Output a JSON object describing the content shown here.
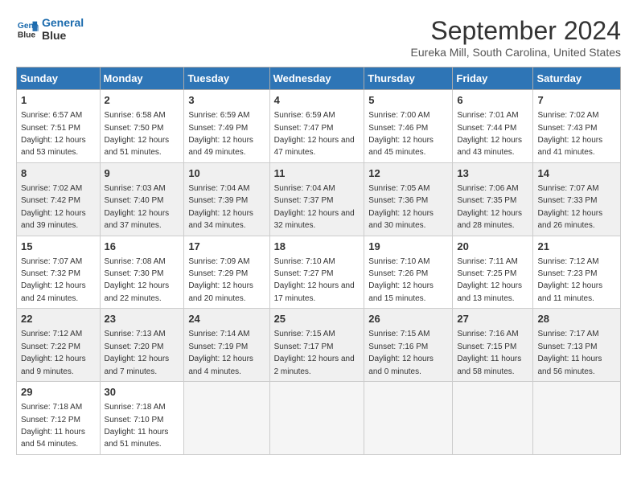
{
  "logo": {
    "line1": "General",
    "line2": "Blue"
  },
  "title": "September 2024",
  "subtitle": "Eureka Mill, South Carolina, United States",
  "days_of_week": [
    "Sunday",
    "Monday",
    "Tuesday",
    "Wednesday",
    "Thursday",
    "Friday",
    "Saturday"
  ],
  "weeks": [
    [
      {
        "day": "1",
        "sunrise": "Sunrise: 6:57 AM",
        "sunset": "Sunset: 7:51 PM",
        "daylight": "Daylight: 12 hours and 53 minutes."
      },
      {
        "day": "2",
        "sunrise": "Sunrise: 6:58 AM",
        "sunset": "Sunset: 7:50 PM",
        "daylight": "Daylight: 12 hours and 51 minutes."
      },
      {
        "day": "3",
        "sunrise": "Sunrise: 6:59 AM",
        "sunset": "Sunset: 7:49 PM",
        "daylight": "Daylight: 12 hours and 49 minutes."
      },
      {
        "day": "4",
        "sunrise": "Sunrise: 6:59 AM",
        "sunset": "Sunset: 7:47 PM",
        "daylight": "Daylight: 12 hours and 47 minutes."
      },
      {
        "day": "5",
        "sunrise": "Sunrise: 7:00 AM",
        "sunset": "Sunset: 7:46 PM",
        "daylight": "Daylight: 12 hours and 45 minutes."
      },
      {
        "day": "6",
        "sunrise": "Sunrise: 7:01 AM",
        "sunset": "Sunset: 7:44 PM",
        "daylight": "Daylight: 12 hours and 43 minutes."
      },
      {
        "day": "7",
        "sunrise": "Sunrise: 7:02 AM",
        "sunset": "Sunset: 7:43 PM",
        "daylight": "Daylight: 12 hours and 41 minutes."
      }
    ],
    [
      {
        "day": "8",
        "sunrise": "Sunrise: 7:02 AM",
        "sunset": "Sunset: 7:42 PM",
        "daylight": "Daylight: 12 hours and 39 minutes."
      },
      {
        "day": "9",
        "sunrise": "Sunrise: 7:03 AM",
        "sunset": "Sunset: 7:40 PM",
        "daylight": "Daylight: 12 hours and 37 minutes."
      },
      {
        "day": "10",
        "sunrise": "Sunrise: 7:04 AM",
        "sunset": "Sunset: 7:39 PM",
        "daylight": "Daylight: 12 hours and 34 minutes."
      },
      {
        "day": "11",
        "sunrise": "Sunrise: 7:04 AM",
        "sunset": "Sunset: 7:37 PM",
        "daylight": "Daylight: 12 hours and 32 minutes."
      },
      {
        "day": "12",
        "sunrise": "Sunrise: 7:05 AM",
        "sunset": "Sunset: 7:36 PM",
        "daylight": "Daylight: 12 hours and 30 minutes."
      },
      {
        "day": "13",
        "sunrise": "Sunrise: 7:06 AM",
        "sunset": "Sunset: 7:35 PM",
        "daylight": "Daylight: 12 hours and 28 minutes."
      },
      {
        "day": "14",
        "sunrise": "Sunrise: 7:07 AM",
        "sunset": "Sunset: 7:33 PM",
        "daylight": "Daylight: 12 hours and 26 minutes."
      }
    ],
    [
      {
        "day": "15",
        "sunrise": "Sunrise: 7:07 AM",
        "sunset": "Sunset: 7:32 PM",
        "daylight": "Daylight: 12 hours and 24 minutes."
      },
      {
        "day": "16",
        "sunrise": "Sunrise: 7:08 AM",
        "sunset": "Sunset: 7:30 PM",
        "daylight": "Daylight: 12 hours and 22 minutes."
      },
      {
        "day": "17",
        "sunrise": "Sunrise: 7:09 AM",
        "sunset": "Sunset: 7:29 PM",
        "daylight": "Daylight: 12 hours and 20 minutes."
      },
      {
        "day": "18",
        "sunrise": "Sunrise: 7:10 AM",
        "sunset": "Sunset: 7:27 PM",
        "daylight": "Daylight: 12 hours and 17 minutes."
      },
      {
        "day": "19",
        "sunrise": "Sunrise: 7:10 AM",
        "sunset": "Sunset: 7:26 PM",
        "daylight": "Daylight: 12 hours and 15 minutes."
      },
      {
        "day": "20",
        "sunrise": "Sunrise: 7:11 AM",
        "sunset": "Sunset: 7:25 PM",
        "daylight": "Daylight: 12 hours and 13 minutes."
      },
      {
        "day": "21",
        "sunrise": "Sunrise: 7:12 AM",
        "sunset": "Sunset: 7:23 PM",
        "daylight": "Daylight: 12 hours and 11 minutes."
      }
    ],
    [
      {
        "day": "22",
        "sunrise": "Sunrise: 7:12 AM",
        "sunset": "Sunset: 7:22 PM",
        "daylight": "Daylight: 12 hours and 9 minutes."
      },
      {
        "day": "23",
        "sunrise": "Sunrise: 7:13 AM",
        "sunset": "Sunset: 7:20 PM",
        "daylight": "Daylight: 12 hours and 7 minutes."
      },
      {
        "day": "24",
        "sunrise": "Sunrise: 7:14 AM",
        "sunset": "Sunset: 7:19 PM",
        "daylight": "Daylight: 12 hours and 4 minutes."
      },
      {
        "day": "25",
        "sunrise": "Sunrise: 7:15 AM",
        "sunset": "Sunset: 7:17 PM",
        "daylight": "Daylight: 12 hours and 2 minutes."
      },
      {
        "day": "26",
        "sunrise": "Sunrise: 7:15 AM",
        "sunset": "Sunset: 7:16 PM",
        "daylight": "Daylight: 12 hours and 0 minutes."
      },
      {
        "day": "27",
        "sunrise": "Sunrise: 7:16 AM",
        "sunset": "Sunset: 7:15 PM",
        "daylight": "Daylight: 11 hours and 58 minutes."
      },
      {
        "day": "28",
        "sunrise": "Sunrise: 7:17 AM",
        "sunset": "Sunset: 7:13 PM",
        "daylight": "Daylight: 11 hours and 56 minutes."
      }
    ],
    [
      {
        "day": "29",
        "sunrise": "Sunrise: 7:18 AM",
        "sunset": "Sunset: 7:12 PM",
        "daylight": "Daylight: 11 hours and 54 minutes."
      },
      {
        "day": "30",
        "sunrise": "Sunrise: 7:18 AM",
        "sunset": "Sunset: 7:10 PM",
        "daylight": "Daylight: 11 hours and 51 minutes."
      },
      null,
      null,
      null,
      null,
      null
    ]
  ]
}
